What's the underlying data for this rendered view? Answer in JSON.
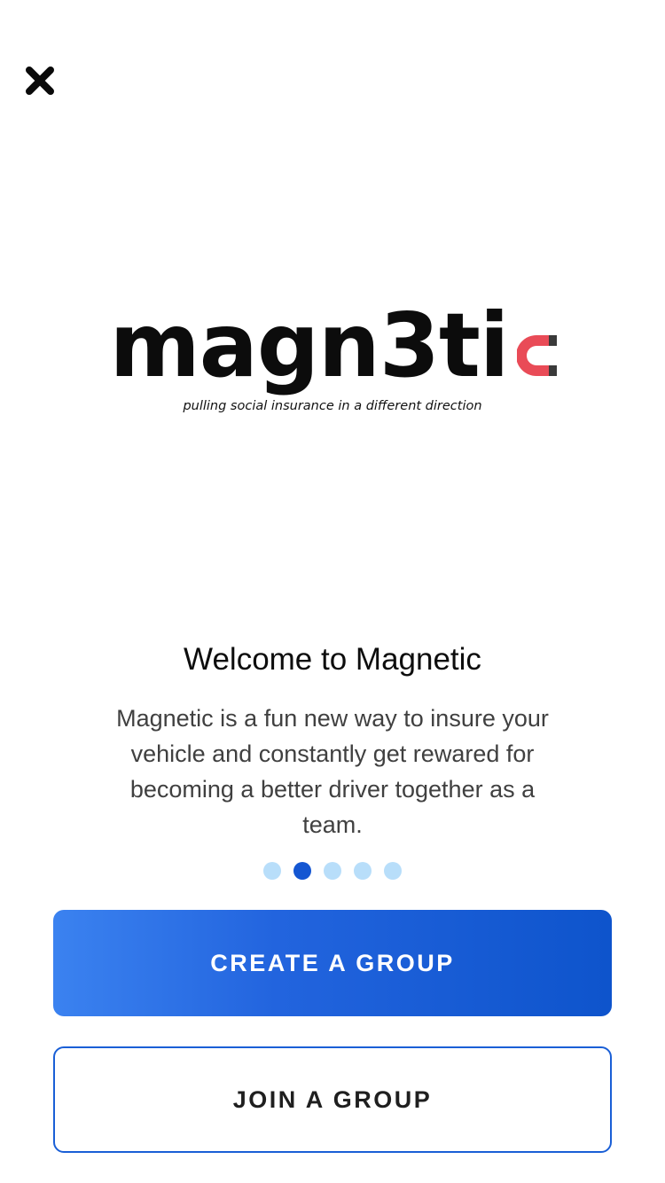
{
  "header": {
    "close_icon": "close-icon"
  },
  "logo": {
    "wordmark": "magn3ti",
    "tagline": "pulling social insurance in a different direction",
    "magnet_colors": {
      "body": "#e94b57",
      "tips": "#3a3a3a"
    }
  },
  "onboarding": {
    "title": "Welcome to Magnetic",
    "description": "Magnetic is a fun new way to insure your vehicle and constantly get rewared for becoming a better driver together as a team.",
    "page_count": 5,
    "active_page": 2
  },
  "actions": {
    "create_label": "CREATE A GROUP",
    "join_label": "JOIN A GROUP"
  },
  "colors": {
    "accent": "#1456d2",
    "dot_inactive": "#b8defa",
    "button_gradient_start": "#3b82f0",
    "button_gradient_end": "#0e54cc"
  }
}
